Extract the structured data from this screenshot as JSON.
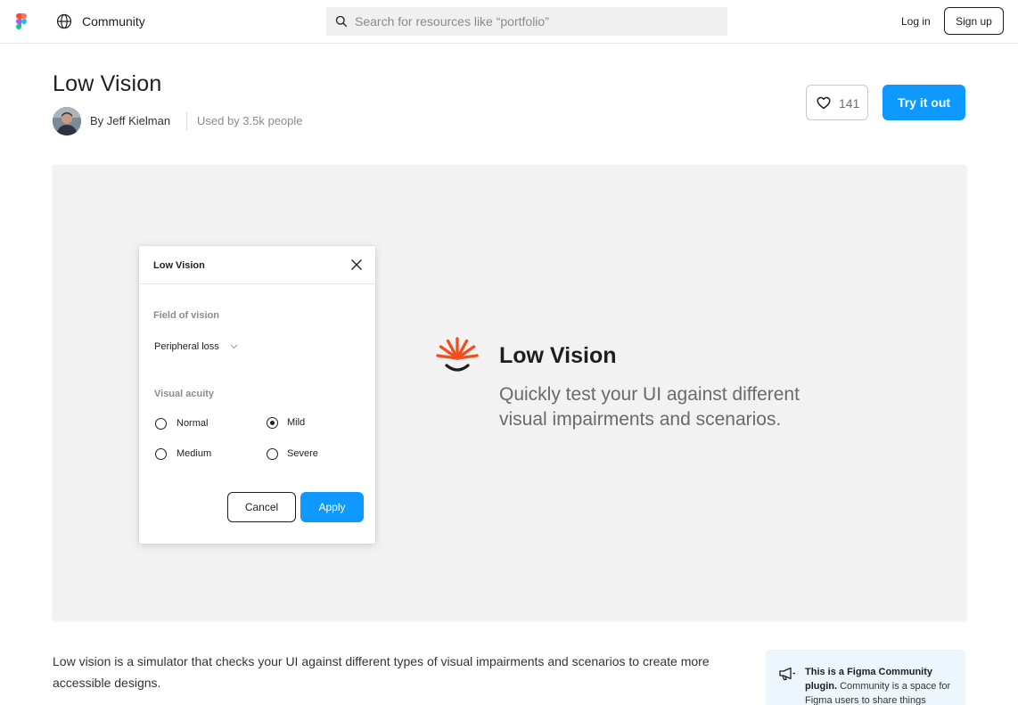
{
  "nav": {
    "logo_icon": "figma-logo-icon",
    "community_label": "Community",
    "search_placeholder": "Search for resources like “portfolio”",
    "login_label": "Log in",
    "signup_label": "Sign up"
  },
  "resource": {
    "title": "Low Vision",
    "author": "By Jeff Kielman",
    "usage": "Used by 3.5k people",
    "like_count": "141",
    "try_label": "Try it out"
  },
  "preview": {
    "dialog": {
      "title": "Low Vision",
      "field_of_vision_label": "Field of vision",
      "field_of_vision_value": "Peripheral loss",
      "visual_acuity_label": "Visual acuity",
      "options": [
        "Normal",
        "Mild",
        "Medium",
        "Severe"
      ],
      "selected_option": "Mild",
      "cancel_label": "Cancel",
      "apply_label": "Apply"
    },
    "brand_name": "Low Vision",
    "tagline_line1": "Quickly test your UI against different",
    "tagline_line2": "visual impairments and scenarios.",
    "brand_color": "#f24e1e"
  },
  "description": {
    "text": "Low vision is a simulator that checks your UI against different types of visual impairments and scenarios to create more accessible designs."
  },
  "info_card": {
    "bold": "This is a Figma Community plugin.",
    "rest": " Community is a space for Figma users to share things"
  },
  "colors": {
    "accent": "#0d99ff",
    "text": "#1e1e1e"
  }
}
